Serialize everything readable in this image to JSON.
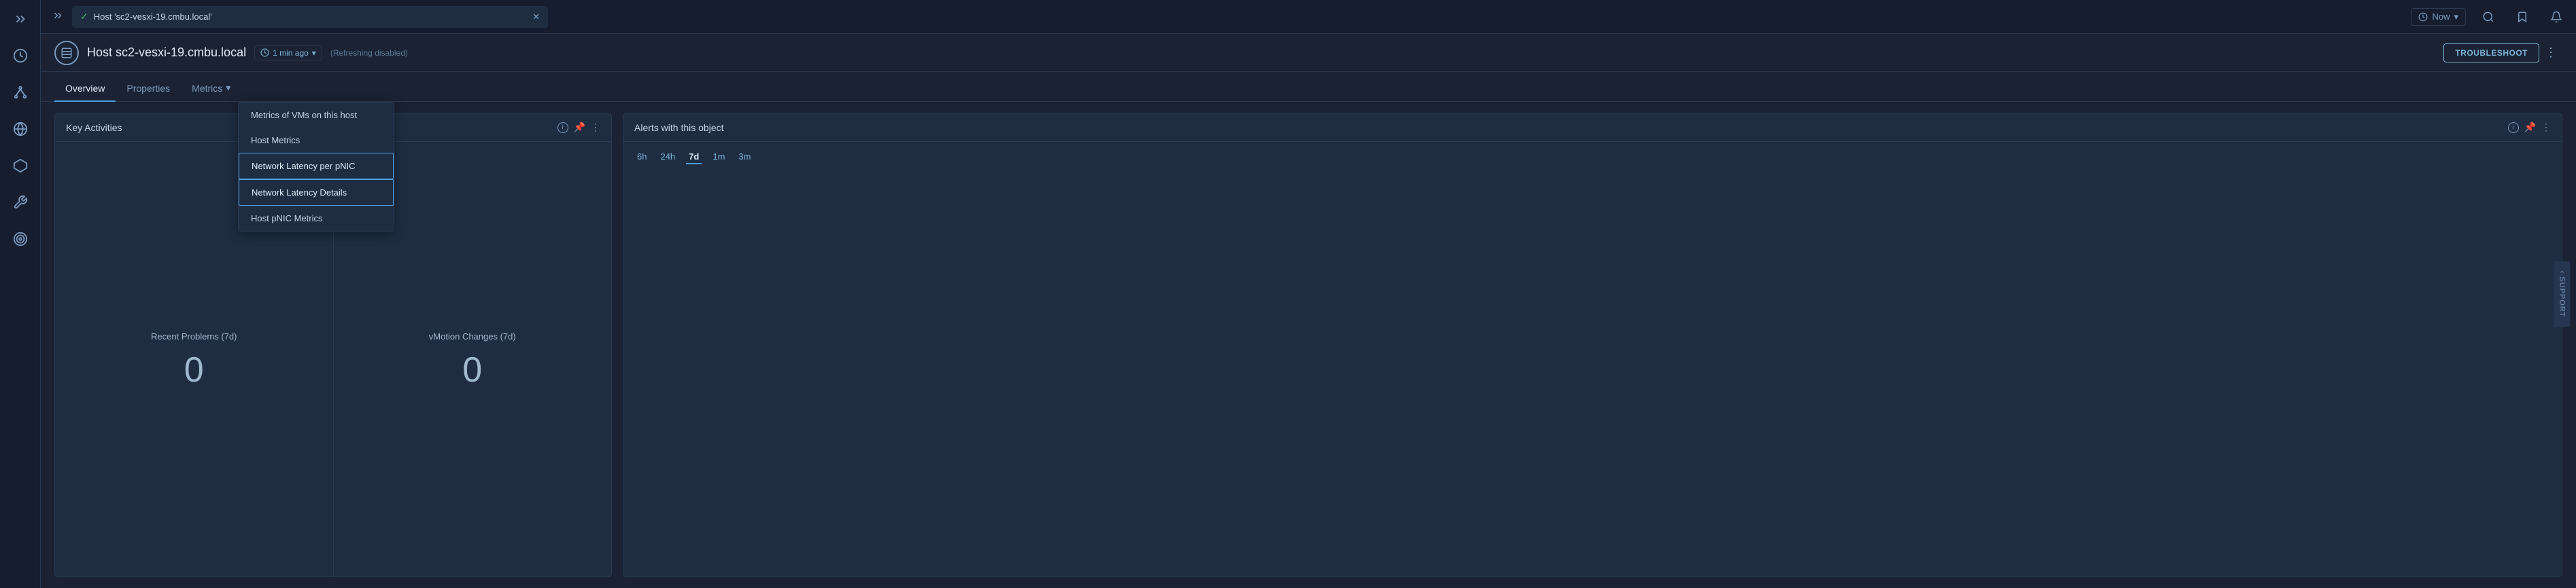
{
  "topbar": {
    "tab_title": "Host 'sc2-vesxi-19.cmbu.local'",
    "now_label": "Now",
    "chevron": "▾"
  },
  "header": {
    "host_label": "Host sc2-vesxi-19.cmbu.local",
    "time_ago": "1 min ago",
    "refreshing_label": "(Refreshing  disabled)",
    "troubleshoot_label": "TROUBLESHOOT"
  },
  "nav": {
    "overview_label": "Overview",
    "properties_label": "Properties",
    "metrics_label": "Metrics"
  },
  "dropdown": {
    "item1": "Metrics of VMs on this host",
    "item2": "Host Metrics",
    "item3": "Network Latency per pNIC",
    "item4": "Network Latency Details",
    "item5": "Host pNIC Metrics"
  },
  "key_activities": {
    "title": "Key Activities",
    "recent_problems_label": "Recent Problems (7d)",
    "recent_problems_value": "0",
    "vmotion_label": "vMotion Changes (7d)",
    "vmotion_value": "0"
  },
  "alerts": {
    "title": "Alerts with this object",
    "time_options": [
      "6h",
      "24h",
      "7d",
      "1m",
      "3m"
    ],
    "active_time": "7d"
  },
  "support": {
    "label": "SUPPORT"
  },
  "icons": {
    "sidebar_dashboard": "⊞",
    "sidebar_hierarchy": "⌥",
    "sidebar_globe": "⊕",
    "sidebar_mesh": "⬡",
    "sidebar_tools": "✕",
    "sidebar_target": "◎"
  }
}
